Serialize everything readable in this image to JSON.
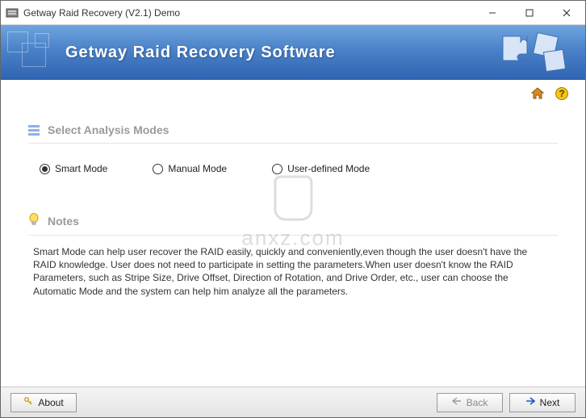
{
  "window": {
    "title": "Getway Raid Recovery (V2.1) Demo"
  },
  "banner": {
    "title": "Getway  Raid  Recovery  Software"
  },
  "icons": {
    "home": "home-icon",
    "help": "help-icon"
  },
  "sections": {
    "modes_title": "Select Analysis Modes",
    "notes_title": "Notes"
  },
  "modes": {
    "options": [
      {
        "label": "Smart Mode",
        "checked": true
      },
      {
        "label": "Manual Mode",
        "checked": false
      },
      {
        "label": "User-defined Mode",
        "checked": false
      }
    ]
  },
  "notes": {
    "text": "Smart Mode can help user recover the RAID easily, quickly and conveniently,even though the user doesn't have the RAID knowledge. User does not need to participate in setting the parameters.When user doesn't know the RAID Parameters, such as Stripe Size, Drive Offset, Direction of Rotation, and Drive Order,  etc., user can choose the Automatic Mode and the system can help him analyze all the parameters."
  },
  "buttons": {
    "about": "About",
    "back": "Back",
    "next": "Next"
  },
  "watermark": {
    "text": "anxz.com"
  }
}
